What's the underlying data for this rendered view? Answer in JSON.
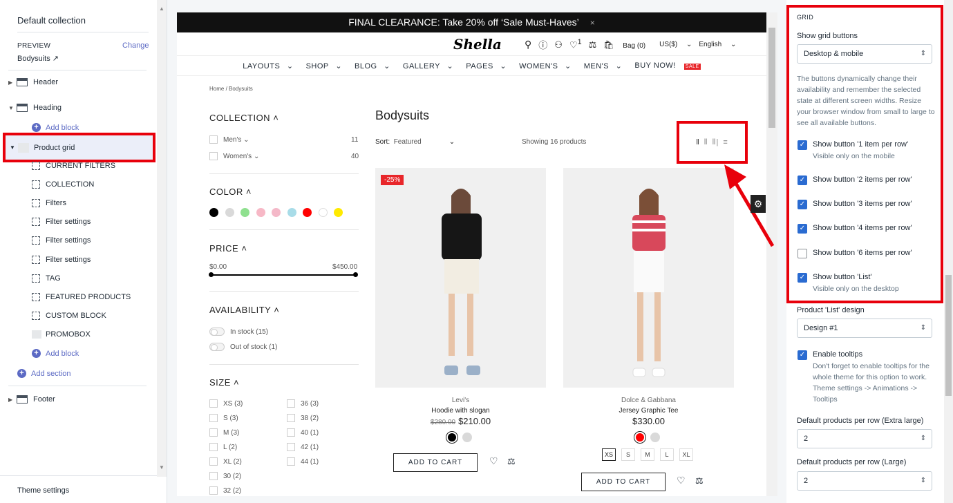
{
  "sidebar": {
    "collection_title": "Default collection",
    "preview_label": "PREVIEW",
    "preview_value": "Bodysuits",
    "change_label": "Change",
    "sections": {
      "header": "Header",
      "heading": "Heading",
      "product_grid": "Product grid",
      "footer": "Footer"
    },
    "add_block": "Add block",
    "blocks": [
      "CURRENT FILTERS",
      "COLLECTION",
      "Filters",
      "Filter settings",
      "Filter settings",
      "Filter settings",
      "TAG",
      "FEATURED PRODUCTS",
      "CUSTOM BLOCK",
      "PROMOBOX"
    ],
    "add_section": "Add section",
    "theme_settings": "Theme settings"
  },
  "store": {
    "announcement": "FINAL CLEARANCE: Take 20% off ‘Sale Must-Haves’",
    "announcement_close": "×",
    "logo": "Shella",
    "bag": "Bag (0)",
    "currency": "US($)",
    "language": "English",
    "wishlist_count": "1",
    "nav": [
      "LAYOUTS",
      "SHOP",
      "BLOG",
      "GALLERY",
      "PAGES",
      "WOMEN'S",
      "MEN'S",
      "BUY NOW!"
    ],
    "sale_badge": "SALE",
    "breadcrumb": "Home  /  Bodysuits",
    "filters": {
      "collection": "COLLECTION",
      "collection_items": [
        {
          "label": "Men's",
          "count": "11"
        },
        {
          "label": "Women's",
          "count": "40"
        }
      ],
      "color": "COLOR",
      "colors": [
        "#000000",
        "#d9d9d9",
        "#8fe08f",
        "#f7b8c6",
        "#f4b8c8",
        "#a8dce8",
        "#ff0000",
        "#ffffff",
        "#ffea00"
      ],
      "price": "PRICE",
      "price_min": "$0.00",
      "price_max": "$450.00",
      "availability": "AVAILABILITY",
      "in_stock": "In stock (15)",
      "out_stock": "Out of stock (1)",
      "size": "SIZE",
      "sizes_left": [
        "XS (3)",
        "S (3)",
        "M (3)",
        "L (2)",
        "XL (2)",
        "30 (2)",
        "32 (2)"
      ],
      "sizes_right": [
        "36 (3)",
        "38 (2)",
        "40 (1)",
        "42 (1)",
        "44 (1)"
      ]
    },
    "page_title": "Bodysuits",
    "sort_label": "Sort:",
    "sort_value": "Featured",
    "showing": "Showing 16 products",
    "products": [
      {
        "discount": "-25%",
        "brand": "Levi's",
        "name": "Hoodie with slogan",
        "old_price": "$280.00",
        "price": "$210.00",
        "atc": "ADD TO CART"
      },
      {
        "brand": "Dolce & Gabbana",
        "name": "Jersey Graphic Tee",
        "price": "$330.00",
        "atc": "ADD TO CART",
        "sizes": [
          "XS",
          "S",
          "M",
          "L",
          "XL"
        ]
      }
    ]
  },
  "settings": {
    "grid_heading": "GRID",
    "show_grid_label": "Show grid buttons",
    "show_grid_value": "Desktop & mobile",
    "help": "The buttons dynamically change their availability and remember the selected state at different screen widths. Resize your browser window from small to large to see all available buttons.",
    "checks": [
      {
        "label": "Show button '1 item per row'",
        "sub": "Visible only on the mobile",
        "checked": true
      },
      {
        "label": "Show button '2 items per row'",
        "checked": true
      },
      {
        "label": "Show button '3 items per row'",
        "checked": true
      },
      {
        "label": "Show button '4 items per row'",
        "checked": true
      },
      {
        "label": "Show button '6 items per row'",
        "checked": false
      },
      {
        "label": "Show button 'List'",
        "sub": "Visible only on the desktop",
        "checked": true
      }
    ],
    "list_design_label": "Product 'List' design",
    "list_design_value": "Design #1",
    "tooltips_label": "Enable tooltips",
    "tooltips_help": "Don't forget to enable tooltips for the whole theme for this option to work. Theme settings -> Animations -> Tooltips",
    "xl_label": "Default products per row (Extra large)",
    "xl_value": "2",
    "l_label": "Default products per row (Large)",
    "l_value": "2"
  }
}
